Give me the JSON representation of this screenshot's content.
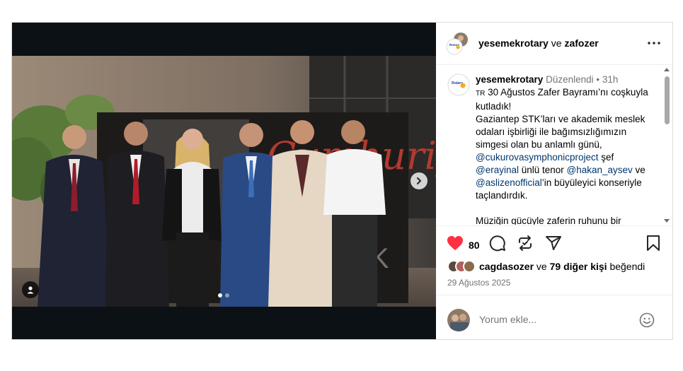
{
  "header": {
    "user1": "yesemekrotary",
    "and": " ve ",
    "user2": "zafozer",
    "avatar_label": "Rotary"
  },
  "caption": {
    "username": "yesemekrotary",
    "edited": "Düzenlendi",
    "bullet": "•",
    "age": "31h",
    "line1_prefix": "TR",
    "line1": " 30 Ağustos Zafer Bayramı’nı coşkuyla kutladık!",
    "line2": "Gaziantep STK’ları ve akademik meslek odaları işbirliği ile bağımsızlığımızın simgesi olan bu anlamlı günü,",
    "mention1": "@cukurovasymphonicproject",
    "after_mention1": " şef",
    "mention2": "@erayinal",
    "after_mention2": " ünlü tenor ",
    "mention3": "@hakan_aysev",
    "after_mention3": " ve",
    "mention4": "@aslizenofficial",
    "after_mention4": "’in büyüleyici konseriyle taçlandırdık.",
    "line_last": "Müziğin gücüyle zaferin ruhunu bir"
  },
  "actions": {
    "like_count": "80",
    "icons": [
      "heart-icon",
      "comment-icon",
      "share-icon",
      "send-icon",
      "bookmark-icon"
    ],
    "like_color": "#ff3040"
  },
  "likes": {
    "first_user": "cagdasozer",
    "middle": " ve ",
    "others": "79 diğer kişi",
    "suffix": " beğendi"
  },
  "date": "29 Ağustos 2025",
  "comment": {
    "placeholder": "Yorum ekle..."
  },
  "media": {
    "slide_index": 1,
    "slide_count": 2
  }
}
